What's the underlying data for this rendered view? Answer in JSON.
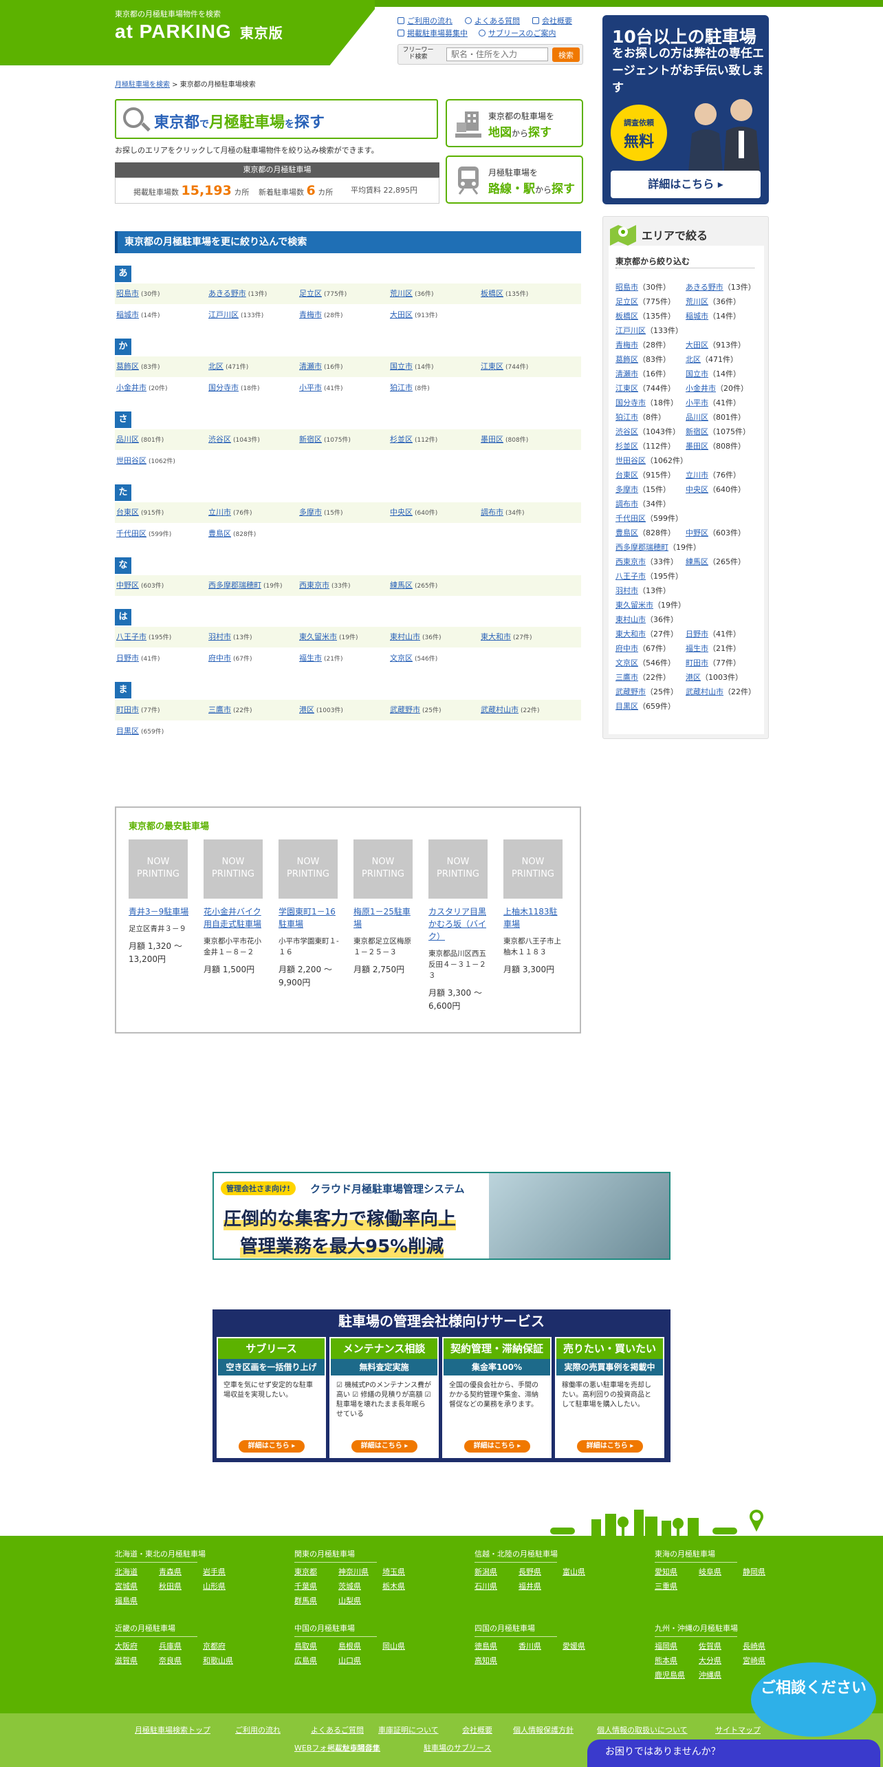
{
  "header": {
    "tagline": "東京都の月極駐車場物件を検索",
    "logo": "at PARKING",
    "edition": "東京版",
    "links": [
      "ご利用の流れ",
      "よくある質問",
      "会社概要",
      "掲載駐車場募集中",
      "サブリースのご案内"
    ],
    "freeword_label": "フリーワード検索",
    "search_placeholder": "駅名・住所を入力",
    "search_button": "検索"
  },
  "breadcrumb": {
    "home": "月極駐車場を検索",
    "sep": " > ",
    "current": "東京都の月極駐車場検索"
  },
  "title_box": {
    "pref": "東京都",
    "de": "で",
    "kw": "月極駐車場",
    "wo": "を",
    "verb": "探す"
  },
  "description": "お探しのエリアをクリックして月極の駐車場物件を絞り込み検索ができます。",
  "stats": {
    "header": "東京都の月極駐車場",
    "listed_label": "掲載駐車場数",
    "listed_value": "15,193",
    "listed_unit": "カ所",
    "new_label": "新着駐車場数",
    "new_value": "6",
    "new_unit": "カ所",
    "avg_label": "平均賃料",
    "avg_value": "22,895円"
  },
  "side_buttons": [
    {
      "line1": "東京都の駐車場を",
      "main": "地図",
      "suffix": "から",
      "main2": "探す"
    },
    {
      "line1": "月極駐車場を",
      "main": "路線・駅",
      "suffix": "から",
      "main2": "探す"
    }
  ],
  "narrow": {
    "header": "東京都の月極駐車場を更に絞り込んで検索",
    "groups": [
      {
        "kana": "あ",
        "rows": [
          [
            [
              "昭島市",
              "(30件)"
            ],
            [
              "あきる野市",
              "(13件)"
            ],
            [
              "足立区",
              "(775件)"
            ],
            [
              "荒川区",
              "(36件)"
            ],
            [
              "板橋区",
              "(135件)"
            ]
          ],
          [
            [
              "稲城市",
              "(14件)"
            ],
            [
              "江戸川区",
              "(133件)"
            ],
            [
              "青梅市",
              "(28件)"
            ],
            [
              "大田区",
              "(913件)"
            ]
          ]
        ]
      },
      {
        "kana": "か",
        "rows": [
          [
            [
              "葛飾区",
              "(83件)"
            ],
            [
              "北区",
              "(471件)"
            ],
            [
              "清瀬市",
              "(16件)"
            ],
            [
              "国立市",
              "(14件)"
            ],
            [
              "江東区",
              "(744件)"
            ]
          ],
          [
            [
              "小金井市",
              "(20件)"
            ],
            [
              "国分寺市",
              "(18件)"
            ],
            [
              "小平市",
              "(41件)"
            ],
            [
              "狛江市",
              "(8件)"
            ]
          ]
        ]
      },
      {
        "kana": "さ",
        "rows": [
          [
            [
              "品川区",
              "(801件)"
            ],
            [
              "渋谷区",
              "(1043件)"
            ],
            [
              "新宿区",
              "(1075件)"
            ],
            [
              "杉並区",
              "(112件)"
            ],
            [
              "墨田区",
              "(808件)"
            ]
          ],
          [
            [
              "世田谷区",
              "(1062件)"
            ]
          ]
        ]
      },
      {
        "kana": "た",
        "rows": [
          [
            [
              "台東区",
              "(915件)"
            ],
            [
              "立川市",
              "(76件)"
            ],
            [
              "多摩市",
              "(15件)"
            ],
            [
              "中央区",
              "(640件)"
            ],
            [
              "調布市",
              "(34件)"
            ]
          ],
          [
            [
              "千代田区",
              "(599件)"
            ],
            [
              "豊島区",
              "(828件)"
            ]
          ]
        ]
      },
      {
        "kana": "な",
        "rows": [
          [
            [
              "中野区",
              "(603件)"
            ],
            [
              "西多摩郡瑞穂町",
              "(19件)"
            ],
            [
              "西東京市",
              "(33件)"
            ],
            [
              "練馬区",
              "(265件)"
            ]
          ]
        ]
      },
      {
        "kana": "は",
        "rows": [
          [
            [
              "八王子市",
              "(195件)"
            ],
            [
              "羽村市",
              "(13件)"
            ],
            [
              "東久留米市",
              "(19件)"
            ],
            [
              "東村山市",
              "(36件)"
            ],
            [
              "東大和市",
              "(27件)"
            ]
          ],
          [
            [
              "日野市",
              "(41件)"
            ],
            [
              "府中市",
              "(67件)"
            ],
            [
              "福生市",
              "(21件)"
            ],
            [
              "文京区",
              "(546件)"
            ]
          ]
        ]
      },
      {
        "kana": "ま",
        "rows": [
          [
            [
              "町田市",
              "(77件)"
            ],
            [
              "三鷹市",
              "(22件)"
            ],
            [
              "港区",
              "(1003件)"
            ],
            [
              "武蔵野市",
              "(25件)"
            ],
            [
              "武蔵村山市",
              "(22件)"
            ]
          ],
          [
            [
              "目黒区",
              "(659件)"
            ]
          ]
        ]
      }
    ]
  },
  "sidebar_ad": {
    "line1": "10台以上の駐車場",
    "line2": "をお探しの方は弊社の専任エージェントがお手伝い致します",
    "badge1": "調査依頼",
    "badge2": "無料",
    "button": "詳細はこちら ▸"
  },
  "area": {
    "title": "エリアで絞る",
    "subtitle": "東京都から絞り込む",
    "items": [
      [
        "昭島市",
        "（30件）"
      ],
      [
        "あきる野市",
        "（13件）"
      ],
      [
        "足立区",
        "（775件）"
      ],
      [
        "荒川区",
        "（36件）"
      ],
      [
        "板橋区",
        "（135件）"
      ],
      [
        "稲城市",
        "（14件）"
      ],
      [
        "江戸川区",
        "（133件）"
      ],
      [
        "青梅市",
        "（28件）"
      ],
      [
        "大田区",
        "（913件）"
      ],
      [
        "葛飾区",
        "（83件）"
      ],
      [
        "北区",
        "（471件）"
      ],
      [
        "清瀬市",
        "（16件）"
      ],
      [
        "国立市",
        "（14件）"
      ],
      [
        "江東区",
        "（744件）"
      ],
      [
        "小金井市",
        "（20件）"
      ],
      [
        "国分寺市",
        "（18件）"
      ],
      [
        "小平市",
        "（41件）"
      ],
      [
        "狛江市",
        "（8件）"
      ],
      [
        "品川区",
        "（801件）"
      ],
      [
        "渋谷区",
        "（1043件）"
      ],
      [
        "新宿区",
        "（1075件）"
      ],
      [
        "杉並区",
        "（112件）"
      ],
      [
        "墨田区",
        "（808件）"
      ],
      [
        "世田谷区",
        "（1062件）"
      ],
      [
        "台東区",
        "（915件）"
      ],
      [
        "立川市",
        "（76件）"
      ],
      [
        "多摩市",
        "（15件）"
      ],
      [
        "中央区",
        "（640件）"
      ],
      [
        "調布市",
        "（34件）"
      ],
      [
        "千代田区",
        "（599件）"
      ],
      [
        "豊島区",
        "（828件）"
      ],
      [
        "中野区",
        "（603件）"
      ],
      [
        "西多摩郡瑞穂町",
        "（19件）"
      ],
      [
        "西東京市",
        "（33件）"
      ],
      [
        "練馬区",
        "（265件）"
      ],
      [
        "八王子市",
        "（195件）"
      ],
      [
        "羽村市",
        "（13件）"
      ],
      [
        "東久留米市",
        "（19件）"
      ],
      [
        "東村山市",
        "（36件）"
      ],
      [
        "東大和市",
        "（27件）"
      ],
      [
        "日野市",
        "（41件）"
      ],
      [
        "府中市",
        "（67件）"
      ],
      [
        "福生市",
        "（21件）"
      ],
      [
        "文京区",
        "（546件）"
      ],
      [
        "町田市",
        "（77件）"
      ],
      [
        "三鷹市",
        "（22件）"
      ],
      [
        "港区",
        "（1003件）"
      ],
      [
        "武蔵野市",
        "（25件）"
      ],
      [
        "武蔵村山市",
        "（22件）"
      ],
      [
        "目黒区",
        "（659件）"
      ]
    ]
  },
  "cheapest": {
    "title": "東京都の最安駐車場",
    "now_printing": "NOW PRINTING",
    "cards": [
      {
        "name": "青井3－9駐車場",
        "addr": "足立区青井３－９",
        "price": "月額 1,320 ～ 13,200円"
      },
      {
        "name": "花小金井バイク用自走式駐車場",
        "addr": "東京都小平市花小金井１－８－２",
        "price": "月額 1,500円"
      },
      {
        "name": "学園東町1－16駐車場",
        "addr": "小平市学園東町１-１６",
        "price": "月額 2,200 ～ 9,900円"
      },
      {
        "name": "梅原1－25駐車場",
        "addr": "東京都足立区梅原１－２５－３",
        "price": "月額 2,750円"
      },
      {
        "name": "カスタリア目黒かむろ坂（バイク）",
        "addr": "東京都品川区西五反田４－３１－２３",
        "price": "月額 3,300 ～ 6,600円"
      },
      {
        "name": "上柚木1183駐車場",
        "addr": "東京都八王子市上柚木１１８３",
        "price": "月額 3,300円"
      }
    ]
  },
  "banner1": {
    "tag": "管理会社さま向け!",
    "title": "クラウド月極駐車場管理システム",
    "line1": "圧倒的な集客力で稼働率向上",
    "line2": "管理業務を最大95%削減"
  },
  "banner2": {
    "title": "駐車場の管理会社様向けサービス",
    "services": [
      {
        "head": "サブリース",
        "sub": "空き区画を一括借り上げ",
        "body": "空車を気にせず安定的な駐車場収益を実現したい。",
        "btn": "詳細はこちら ▸"
      },
      {
        "head": "メンテナンス相談",
        "sub": "無料査定実施",
        "body": "☑ 機械式Pのメンテナンス費が高い ☑ 修繕の見積りが高額 ☑ 駐車場を壊れたまま長年眠らせている",
        "btn": "詳細はこちら ▸"
      },
      {
        "head": "契約管理・滞納保証",
        "sub": "集金率100%",
        "body": "全国の優良会社から、手間のかかる契約管理や集金、滞納督促などの業務を承ります。",
        "btn": "詳細はこちら ▸"
      },
      {
        "head": "売りたい・買いたい",
        "sub": "実際の売買事例を掲載中",
        "body": "稼働率の悪い駐車場を売却したい。高利回りの投資商品として駐車場を購入したい。",
        "btn": "詳細はこちら ▸"
      }
    ]
  },
  "footer": {
    "regions": [
      {
        "title": "北海道・東北の月極駐車場",
        "links": [
          "北海道",
          "青森県",
          "岩手県",
          "宮城県",
          "秋田県",
          "山形県",
          "福島県"
        ]
      },
      {
        "title": "関東の月極駐車場",
        "links": [
          "東京都",
          "神奈川県",
          "埼玉県",
          "千葉県",
          "茨城県",
          "栃木県",
          "群馬県",
          "山梨県"
        ]
      },
      {
        "title": "信越・北陸の月極駐車場",
        "links": [
          "新潟県",
          "長野県",
          "富山県",
          "石川県",
          "福井県"
        ]
      },
      {
        "title": "東海の月極駐車場",
        "links": [
          "愛知県",
          "岐阜県",
          "静岡県",
          "三重県"
        ]
      },
      {
        "title": "近畿の月極駐車場",
        "links": [
          "大阪府",
          "兵庫県",
          "京都府",
          "滋賀県",
          "奈良県",
          "和歌山県"
        ]
      },
      {
        "title": "中国の月極駐車場",
        "links": [
          "鳥取県",
          "島根県",
          "岡山県",
          "広島県",
          "山口県"
        ]
      },
      {
        "title": "四国の月極駐車場",
        "links": [
          "徳島県",
          "香川県",
          "愛媛県",
          "高知県"
        ]
      },
      {
        "title": "九州・沖縄の月極駐車場",
        "links": [
          "福岡県",
          "佐賀県",
          "長崎県",
          "熊本県",
          "大分県",
          "宮崎県",
          "鹿児島県",
          "沖縄県"
        ]
      }
    ],
    "bottom_links": [
      "月極駐車場検索トップ",
      "ご利用の流れ",
      "よくあるご質問",
      "車庫証明について",
      "会社概要",
      "個人情報保護方針",
      "個人情報の取扱いについて",
      "サイトマップ",
      "WEBフォームから問合せ",
      "掲載駐車場募集",
      "駐車場のサブリース"
    ],
    "consult": "ご相談ください",
    "chat": "お困りではありませんか？"
  },
  "colors": {
    "brand_green": "#5cb200",
    "link_blue": "#2a62b8",
    "accent_orange": "#f07800",
    "section_blue": "#1f6fb5"
  }
}
